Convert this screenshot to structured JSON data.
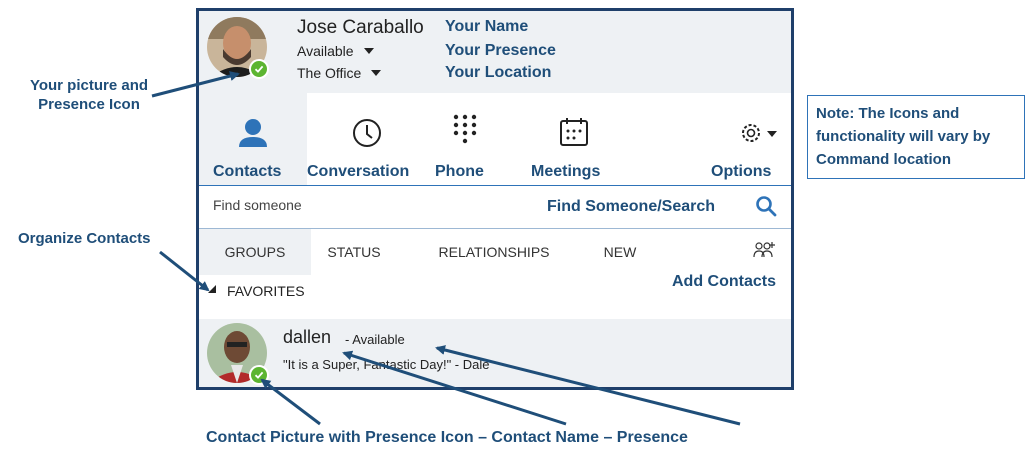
{
  "annotations": {
    "your_picture": "Your picture and Presence Icon",
    "your_name": "Your Name",
    "your_presence": "Your Presence",
    "your_location": "Your Location",
    "note": "Note: The Icons and functionality will vary by Command location",
    "find_search": "Find Someone/Search",
    "organize_contacts": "Organize Contacts",
    "add_contacts": "Add Contacts",
    "bottom_caption": "Contact Picture with Presence Icon – Contact Name – Presence"
  },
  "user": {
    "name": "Jose Caraballo",
    "presence": "Available",
    "location": "The Office",
    "presence_color": "#5cb531"
  },
  "nav": {
    "items": [
      {
        "label": "Contacts",
        "icon": "person-icon"
      },
      {
        "label": "Conversation",
        "icon": "clock-icon"
      },
      {
        "label": "Phone",
        "icon": "dialpad-icon"
      },
      {
        "label": "Meetings",
        "icon": "calendar-icon"
      },
      {
        "label": "Options",
        "icon": "gear-icon"
      }
    ]
  },
  "search": {
    "placeholder": "Find someone"
  },
  "tabs": [
    "GROUPS",
    "STATUS",
    "RELATIONSHIPS",
    "NEW"
  ],
  "group": {
    "name": "FAVORITES"
  },
  "contact": {
    "name": "dallen",
    "status": "- Available",
    "note": "\"It is a Super, Fantastic Day!\" - Dale"
  },
  "colors": {
    "accent": "#1f4e79",
    "frame": "#1f3f6a",
    "icon_blue": "#2e73b8",
    "presence": "#5cb531",
    "panel": "#eef1f4"
  }
}
